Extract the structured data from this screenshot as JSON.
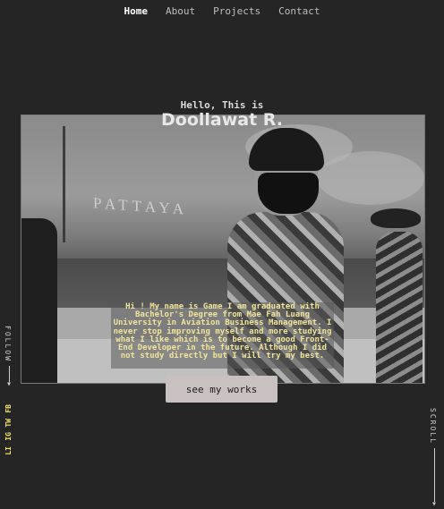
{
  "nav": [
    {
      "label": "Home",
      "active": true
    },
    {
      "label": "About"
    },
    {
      "label": "Projects"
    },
    {
      "label": "Contact"
    }
  ],
  "hero": {
    "greeting": "Hello, This is",
    "name": "Doollawat R.",
    "intro": "Hi ! My name is Game I am graduated with Bachelor's Degree from Mae Fah Luang University in Aviation Business Management. I never stop improving myself and more studying what I like which is to become a good Front-End Developer in the future. Although I did not study directly but I will try my best.",
    "photo_sign": "PATTAYA",
    "cta": "see my works"
  },
  "follow": {
    "label": "FOLLOW",
    "socials": [
      "FB",
      "TW",
      "IG",
      "LI"
    ]
  },
  "scroll_label": "SCROLL",
  "colors": {
    "background": "#252525",
    "accent": "#f5e663",
    "button": "#c9c0c0"
  }
}
